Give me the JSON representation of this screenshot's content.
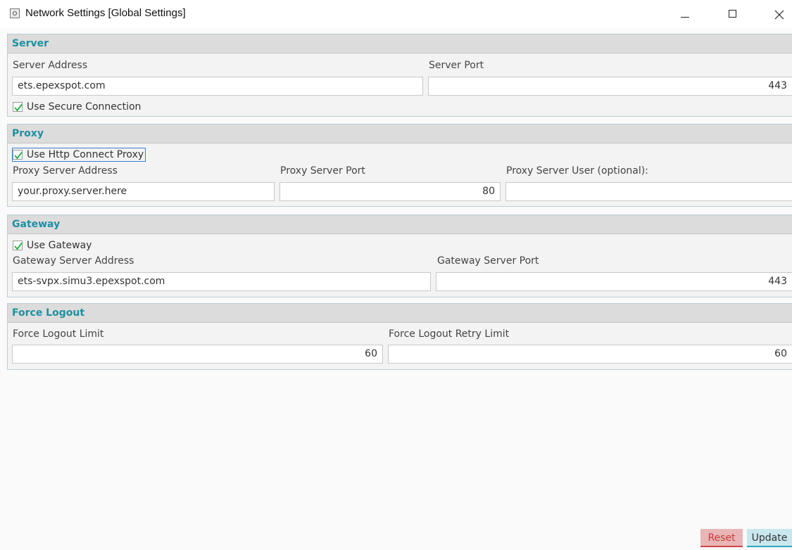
{
  "window": {
    "title": "Network Settings [Global Settings]"
  },
  "server": {
    "heading": "Server",
    "address_label": "Server Address",
    "address_value": "ets.epexspot.com",
    "port_label": "Server Port",
    "port_value": "443",
    "secure_label": "Use Secure Connection",
    "secure_checked": true
  },
  "proxy": {
    "heading": "Proxy",
    "use_label": "Use Http Connect Proxy",
    "use_checked": true,
    "address_label": "Proxy Server Address",
    "address_value": "your.proxy.server.here",
    "port_label": "Proxy Server Port",
    "port_value": "80",
    "user_label": "Proxy Server User (optional):",
    "user_value": ""
  },
  "gateway": {
    "heading": "Gateway",
    "use_label": "Use Gateway",
    "use_checked": true,
    "address_label": "Gateway Server Address",
    "address_value": "ets-svpx.simu3.epexspot.com",
    "port_label": "Gateway Server Port",
    "port_value": "443"
  },
  "force_logout": {
    "heading": "Force Logout",
    "limit_label": "Force Logout Limit",
    "limit_value": "60",
    "retry_label": "Force Logout Retry Limit",
    "retry_value": "60"
  },
  "buttons": {
    "reset": "Reset",
    "update": "Update"
  },
  "colors": {
    "heading": "#1e8fa0",
    "check": "#2bb24c",
    "reset": "#cc3a3a",
    "update_accent": "#2aa7bd"
  }
}
